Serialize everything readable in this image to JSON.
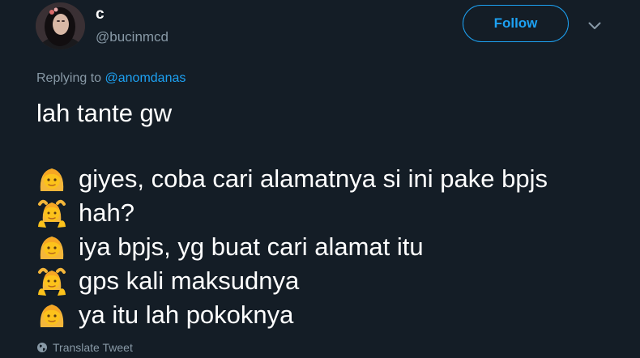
{
  "author": {
    "display_name": "c",
    "handle": "@bucinmcd",
    "avatar": "avatar-photo"
  },
  "follow_button": {
    "label": "Follow"
  },
  "more_menu": {
    "icon": "chevron-down-icon"
  },
  "reply_context": {
    "prefix": "Replying to ",
    "mention": "@anomdanas"
  },
  "tweet": {
    "text": "lah tante gw",
    "lines": [
      {
        "emoji": "woman-emoji",
        "text": "giyes, coba cari alamatnya si ini pake bpjs"
      },
      {
        "emoji": "woman-gesturing-ok-emoji",
        "text": "hah?"
      },
      {
        "emoji": "woman-emoji",
        "text": "iya bpjs, yg buat cari alamat itu"
      },
      {
        "emoji": "woman-gesturing-ok-emoji",
        "text": "gps kali maksudnya"
      },
      {
        "emoji": "woman-emoji",
        "text": "ya itu lah pokoknya"
      }
    ]
  },
  "translate": {
    "label": "Translate Tweet",
    "icon": "globe-icon"
  },
  "colors": {
    "background": "#141d26",
    "text": "#ffffff",
    "muted": "#8899a6",
    "accent": "#1da1f2"
  }
}
